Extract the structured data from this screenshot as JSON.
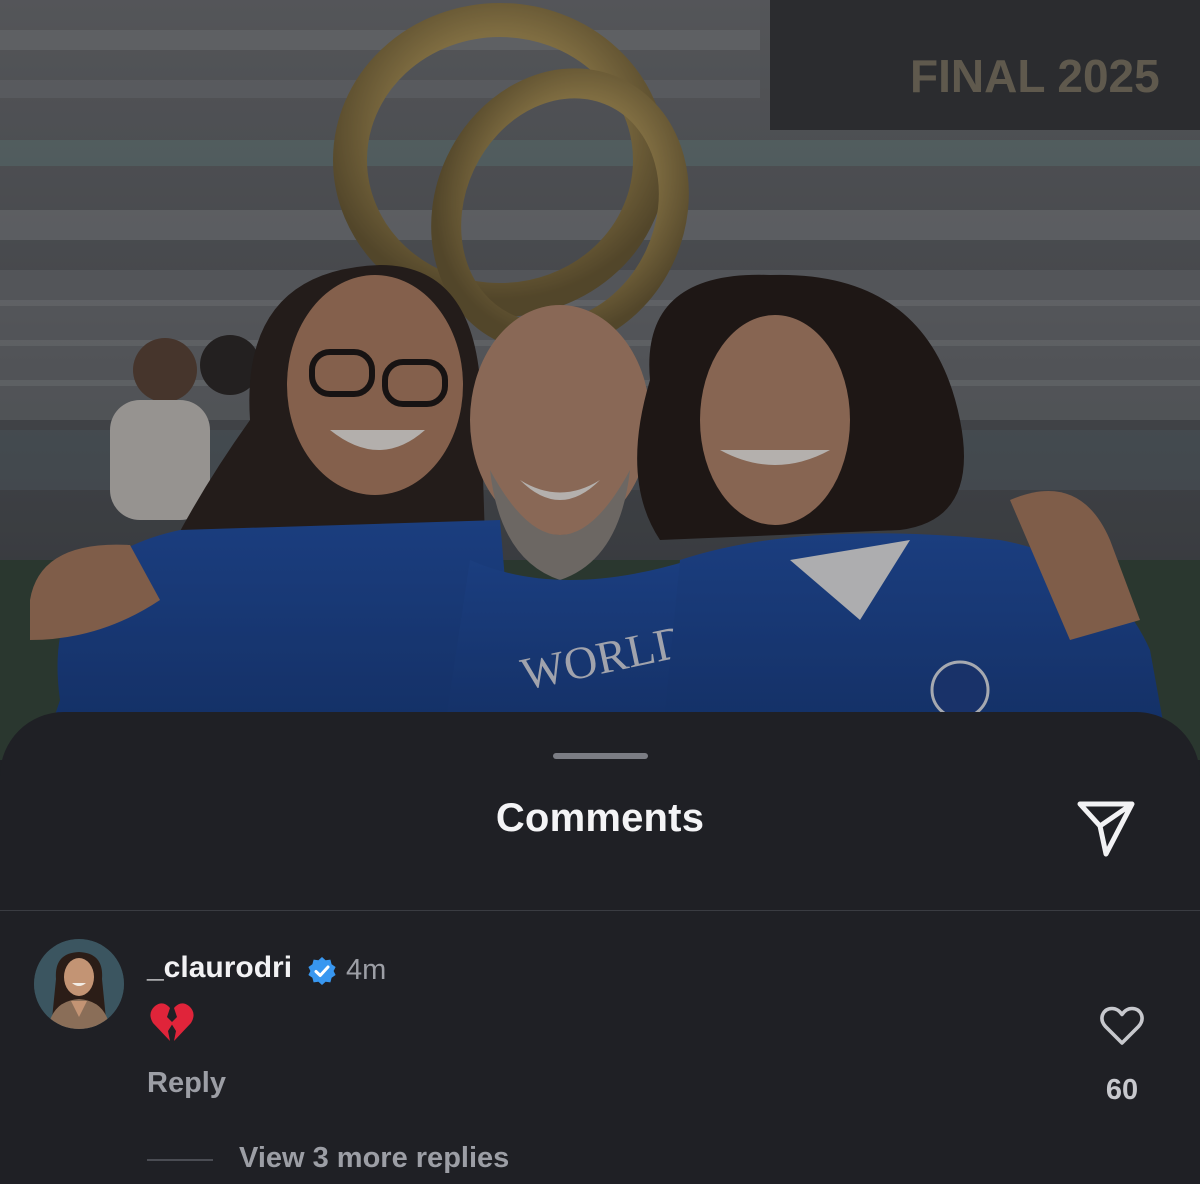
{
  "sheet": {
    "title": "Comments"
  },
  "photo": {
    "screen_text": "FINAL 2025",
    "jersey_text": "WORLD CHAMPIONS"
  },
  "comment": {
    "username": "_claurodri",
    "verified": true,
    "time": "4m",
    "text": "💔",
    "reply_label": "Reply",
    "like_count": "60",
    "view_replies_label": "View 3 more replies"
  },
  "icons": {
    "share": "paper-plane-icon",
    "like": "heart-outline-icon",
    "verified": "verified-badge-icon"
  },
  "colors": {
    "sheet_bg": "#1f2025",
    "verified_blue": "#3897f0",
    "secondary_text": "#9c9ea5",
    "primary_text": "#f2f2f4"
  }
}
